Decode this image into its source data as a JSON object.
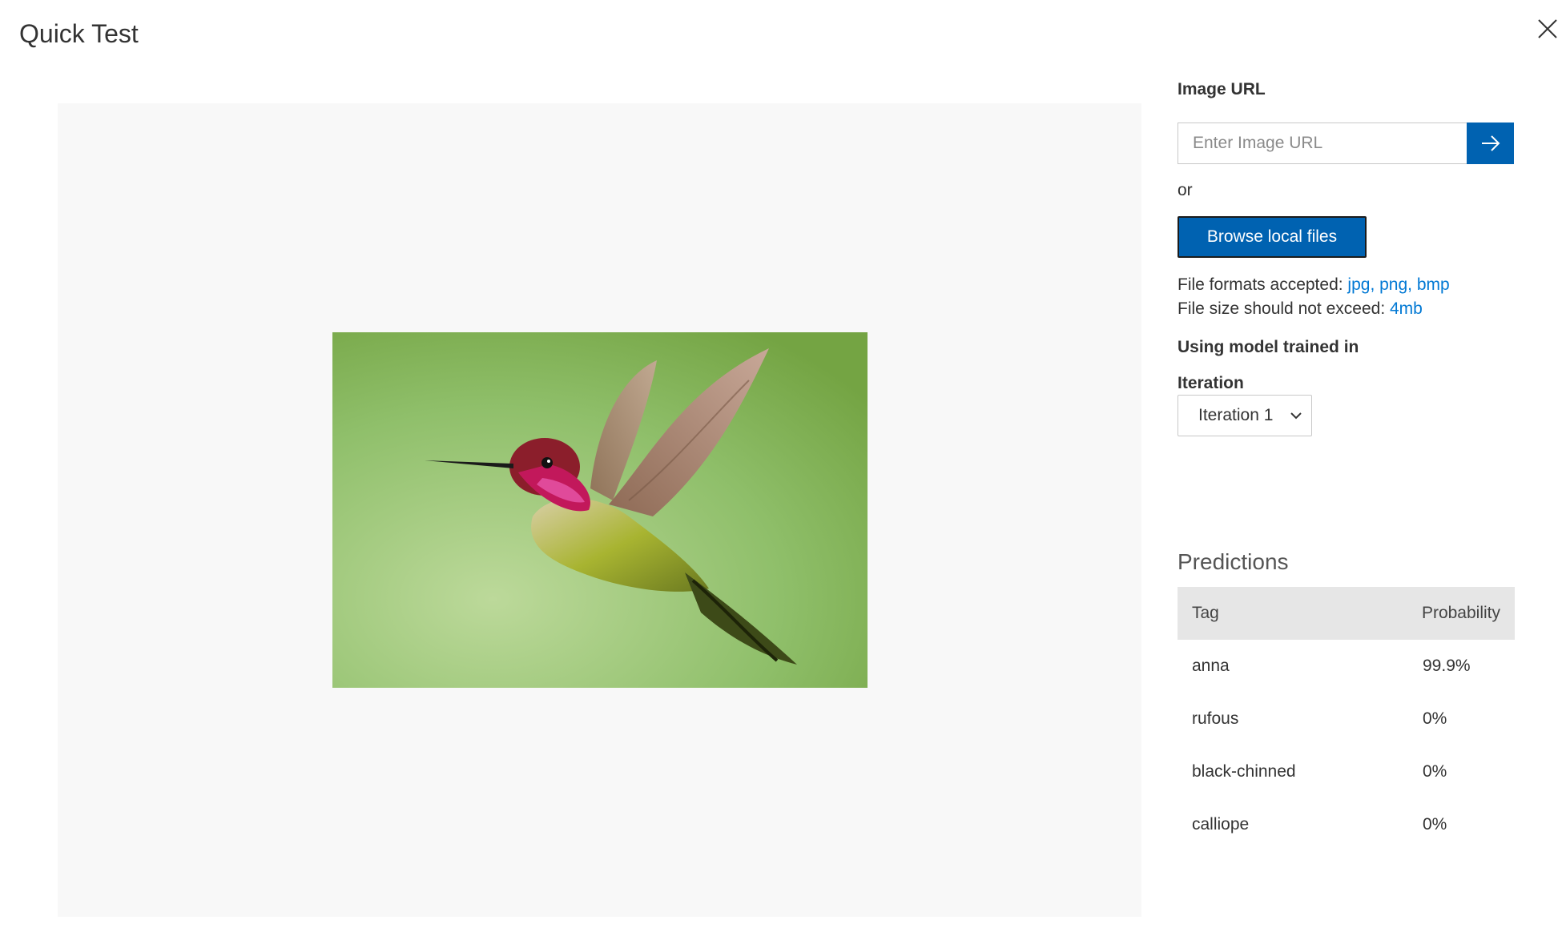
{
  "dialog": {
    "title": "Quick Test",
    "close_icon": "close-icon"
  },
  "preview": {
    "image_description_icon": "hummingbird-image"
  },
  "url": {
    "label": "Image URL",
    "placeholder": "Enter Image URL",
    "value": "",
    "submit_icon": "arrow-right-icon"
  },
  "or_text": "or",
  "browse_label": "Browse local files",
  "formats": {
    "prefix": "File formats accepted: ",
    "value": "jpg, png, bmp"
  },
  "size": {
    "prefix": "File size should not exceed: ",
    "value": "4mb"
  },
  "model_label": "Using model trained in",
  "iteration": {
    "label": "Iteration",
    "selected": "Iteration 1"
  },
  "predictions": {
    "title": "Predictions",
    "headers": [
      "Tag",
      "Probability"
    ],
    "rows": [
      {
        "tag": "anna",
        "probability": "99.9%"
      },
      {
        "tag": "rufous",
        "probability": "0%"
      },
      {
        "tag": "black-chinned",
        "probability": "0%"
      },
      {
        "tag": "calliope",
        "probability": "0%"
      }
    ]
  },
  "colors": {
    "accent": "#0062b1",
    "link": "#0078d4",
    "preview_bg": "#f8f8f8",
    "table_header_bg": "#e6e6e6"
  }
}
